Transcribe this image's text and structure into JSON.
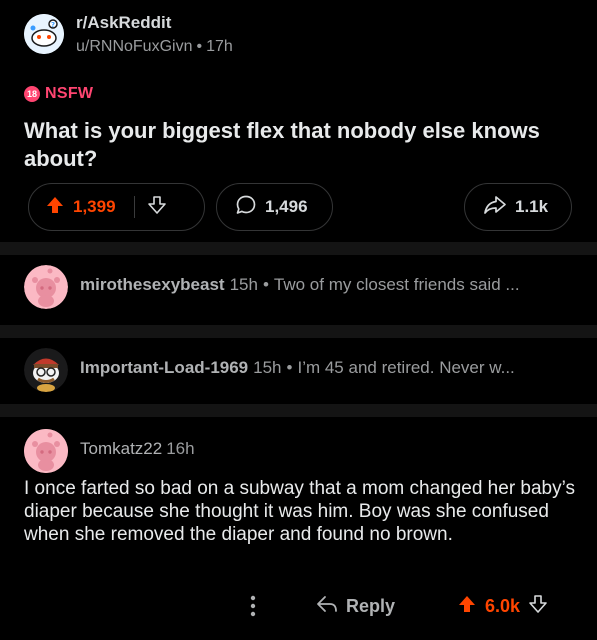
{
  "post": {
    "subreddit": "r/AskReddit",
    "author": "u/RNNoFuxGivn",
    "age": "17h",
    "nsfw_badge": "18",
    "nsfw_label": "NSFW",
    "title": "What is your biggest flex that nobody else knows about?",
    "upvotes": "1,399",
    "comments": "1,496",
    "shares": "1.1k",
    "upvote_color": "#ff4500"
  },
  "comments": [
    {
      "user": "mirothesexybeast",
      "age": "15h",
      "snippet": "Two of my closest friends said ...",
      "avatar": "snoo-pink-avatar"
    },
    {
      "user": "Important-Load-1969",
      "age": "15h",
      "snippet": "I’m 45 and retired.  Never w...",
      "avatar": "snoo-custom-avatar"
    },
    {
      "user": "Tomkatz22",
      "age": "16h",
      "body": "I once farted so bad on a subway that a mom changed her baby’s diaper because she thought it was him. Boy was she confused when she removed the diaper and found no brown.",
      "reply_label": "Reply",
      "score": "6.0k",
      "avatar": "snoo-pink-avatar"
    }
  ],
  "colors": {
    "accent": "#ff4500",
    "nsfw": "#ff4571",
    "background": "#000000"
  }
}
